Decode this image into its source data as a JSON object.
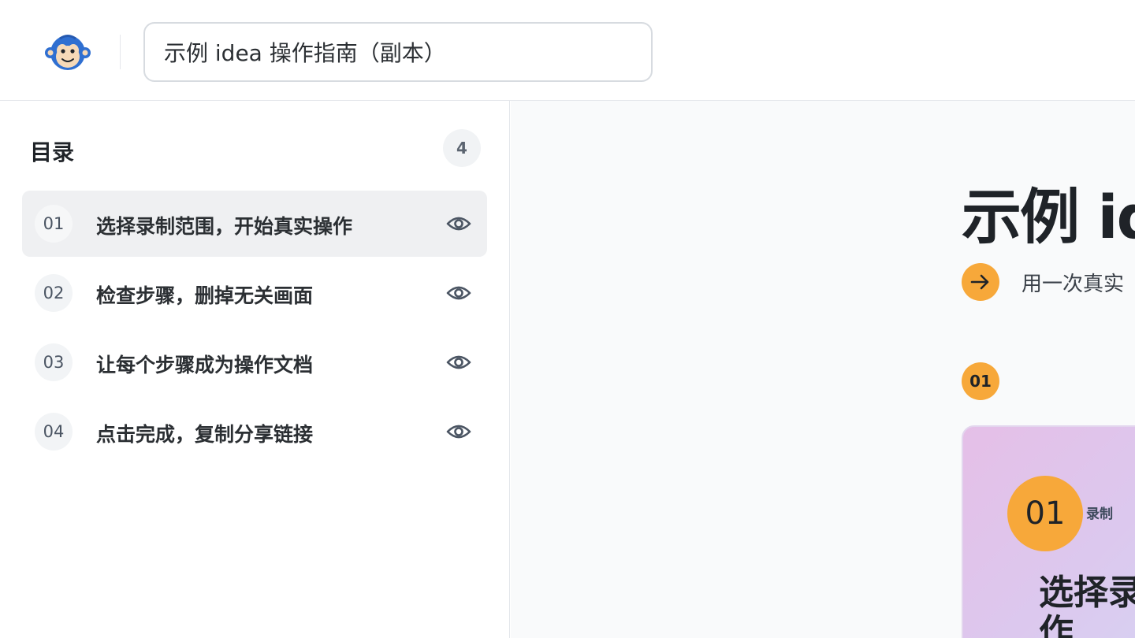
{
  "header": {
    "logo_icon": "monkey-logo-icon",
    "doc_title_value": "示例 idea 操作指南（副本）"
  },
  "sidebar": {
    "title": "目录",
    "count": "4",
    "items": [
      {
        "num": "01",
        "label": "选择录制范围，开始真实操作",
        "icon": "eye-icon",
        "active": true
      },
      {
        "num": "02",
        "label": "检查步骤，删掉无关画面",
        "icon": "eye-icon",
        "active": false
      },
      {
        "num": "03",
        "label": "让每个步骤成为操作文档",
        "icon": "eye-icon",
        "active": false
      },
      {
        "num": "04",
        "label": "点击完成，复制分享链接",
        "icon": "eye-icon",
        "active": false
      }
    ]
  },
  "main": {
    "title": "示例 ide",
    "intro_icon": "arrow-right-icon",
    "intro_text": "用一次真实",
    "step_badge": "01",
    "card": {
      "num": "01",
      "tag": "录制",
      "heading": "选择录 操作"
    }
  },
  "colors": {
    "accent": "#f7a83a",
    "active_row": "#eff0f2",
    "main_bg": "#f9fafb",
    "logo_blue": "#2f6fd1"
  }
}
